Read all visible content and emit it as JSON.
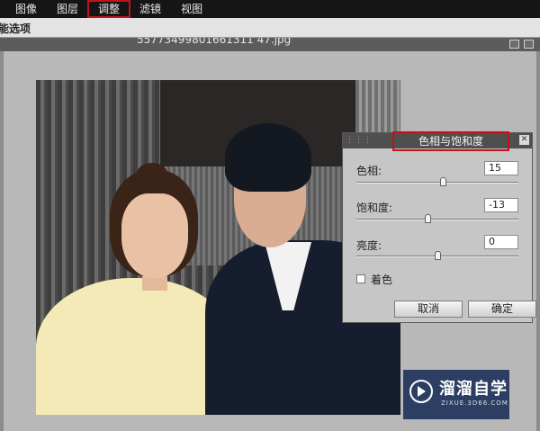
{
  "menubar": {
    "items": [
      "图像",
      "图层",
      "调整",
      "滤镜",
      "视图"
    ],
    "highlighted": "调整"
  },
  "optionsbar": {
    "label": "能选项"
  },
  "document": {
    "title": "55773499801661311 47.jpg"
  },
  "dialog": {
    "title": "色相与饱和度",
    "hue": {
      "label": "色相:",
      "value": "15",
      "level": 0.54
    },
    "saturation": {
      "label": "饱和度:",
      "value": "-13",
      "level": 0.44
    },
    "lightness": {
      "label": "亮度:",
      "value": "0",
      "level": 0.5
    },
    "colorize_label": "着色",
    "cancel_label": "取消",
    "ok_label": "确定",
    "close_glyph": "✕"
  },
  "watermark": {
    "brand": "溜溜自学",
    "url": "ZIXUE.3D66.COM"
  },
  "colors": {
    "highlight": "#c4121b",
    "menubar": "#151515",
    "watermark_bg": "#2c3f63"
  }
}
